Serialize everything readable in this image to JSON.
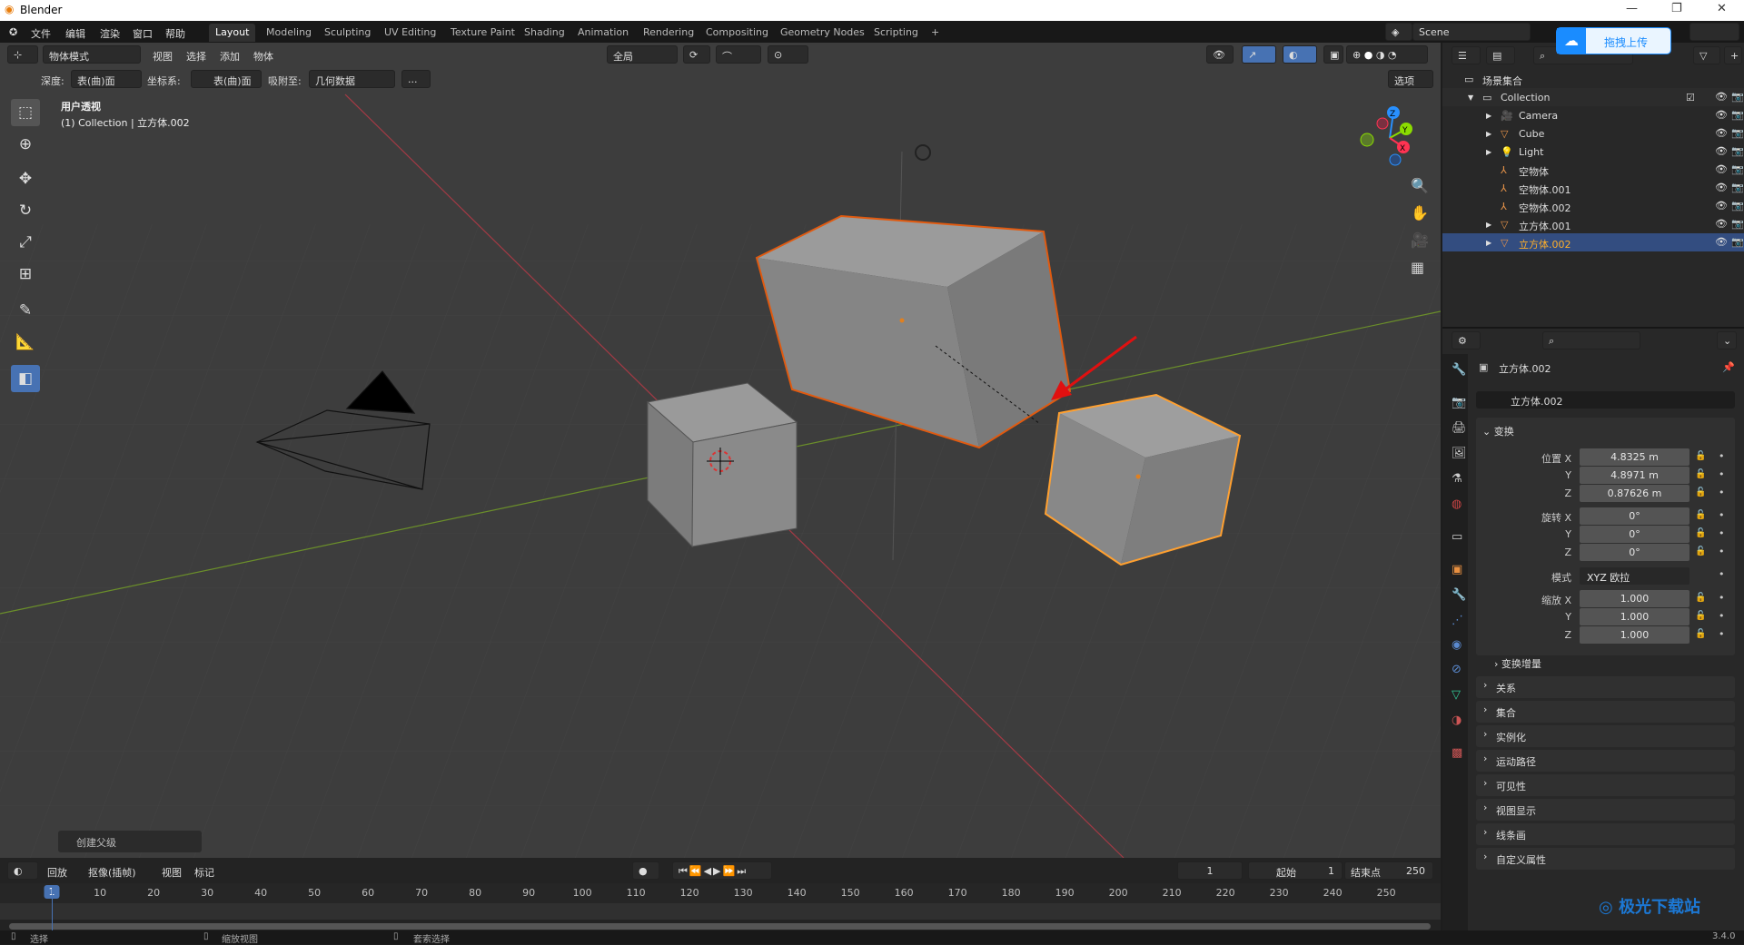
{
  "window": {
    "title": "Blender",
    "min": "—",
    "max": "❐",
    "close": "✕"
  },
  "menu": [
    "文件",
    "编辑",
    "渲染",
    "窗口",
    "帮助"
  ],
  "workspaces": [
    "Layout",
    "Modeling",
    "Sculpting",
    "UV Editing",
    "Texture Paint",
    "Shading",
    "Animation",
    "Rendering",
    "Compositing",
    "Geometry Nodes",
    "Scripting",
    "+"
  ],
  "scene": "Scene",
  "upload": {
    "label": "拖拽上传",
    "color": "#1a8cff"
  },
  "viewport_header": {
    "mode": "物体模式",
    "menus": [
      "视图",
      "选择",
      "添加",
      "物体"
    ],
    "transform": "全局"
  },
  "tool_header": {
    "depth_label": "深度:",
    "depth": "表(曲)面",
    "coord_label": "坐标系:",
    "coord": "表(曲)面",
    "snap_label": "吸附至:",
    "snap": "几何数据",
    "more": "...",
    "options": "选项"
  },
  "overlay_text": {
    "view": "用户透视",
    "collection": "(1) Collection | 立方体.002"
  },
  "last_op": "创建父级",
  "gizmo": {
    "x": "X",
    "y": "Y",
    "z": "Z",
    "x_color": "#ff3352",
    "y_color": "#8bdc00",
    "z_color": "#2890ff"
  },
  "outliner": {
    "root": "场景集合",
    "collection": "Collection",
    "items": [
      {
        "name": "Camera",
        "icon": "camera-icon",
        "expand": true
      },
      {
        "name": "Cube",
        "icon": "mesh-icon",
        "expand": true
      },
      {
        "name": "Light",
        "icon": "light-icon",
        "expand": true
      },
      {
        "name": "空物体",
        "icon": "empty-icon",
        "expand": false
      },
      {
        "name": "空物体.001",
        "icon": "empty-icon",
        "expand": false
      },
      {
        "name": "空物体.002",
        "icon": "empty-icon",
        "expand": false
      },
      {
        "name": "立方体.001",
        "icon": "mesh-icon",
        "expand": true
      },
      {
        "name": "立方体.002",
        "icon": "mesh-icon",
        "expand": true,
        "selected": true
      }
    ]
  },
  "properties": {
    "object_name": "立方体.002",
    "data_name": "立方体.002",
    "transform": "变换",
    "location_label": "位置 X",
    "rotation_label": "旋转 X",
    "mode_label": "模式",
    "scale_label": "缩放 X",
    "y": "Y",
    "z": "Z",
    "location": [
      "4.8325 m",
      "4.8971 m",
      "0.87626 m"
    ],
    "rotation": [
      "0°",
      "0°",
      "0°"
    ],
    "rotation_mode": "XYZ 欧拉",
    "scale": [
      "1.000",
      "1.000",
      "1.000"
    ],
    "delta": "变换增量",
    "panels": [
      "关系",
      "集合",
      "实例化",
      "运动路径",
      "可见性",
      "视图显示",
      "线条画",
      "自定义属性"
    ]
  },
  "timeline": {
    "menus": [
      "回放",
      "抠像(插帧)",
      "视图",
      "标记"
    ],
    "current": "1",
    "start_label": "起始",
    "start": "1",
    "end_label": "结束点",
    "end": "250",
    "ticks": [
      "1",
      "10",
      "20",
      "30",
      "40",
      "50",
      "60",
      "70",
      "80",
      "90",
      "100",
      "110",
      "120",
      "130",
      "140",
      "150",
      "160",
      "170",
      "180",
      "190",
      "200",
      "210",
      "220",
      "230",
      "240",
      "250"
    ]
  },
  "status": {
    "select": "选择",
    "zoom": "缩放视图",
    "lasso": "套索选择",
    "version": "3.4.0"
  },
  "watermark": "极光下载站"
}
